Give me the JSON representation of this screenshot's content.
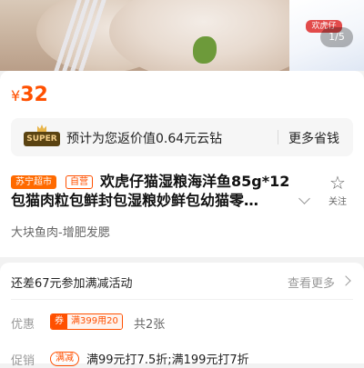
{
  "gallery": {
    "pager": "1/5",
    "brand": "欢虎仔"
  },
  "price": {
    "currency": "¥",
    "value": "32",
    "color": "#ff5000"
  },
  "cashback": {
    "badge": "SUPER",
    "text": "预计为您返价值0.64元云钻",
    "link": "更多省钱"
  },
  "product": {
    "store_tag": "苏宁超市",
    "self_tag": "自营",
    "title_line1": "欢虎仔猫湿粮海洋鱼85g*12",
    "title_line2": "包猫肉粒包鲜封包湿粮妙鲜包幼猫零…",
    "favorite_label": "关注",
    "favorite_icon": "star-outline-icon",
    "subtitle": "大块鱼肉-增肥发腮"
  },
  "promotions": {
    "threshold_text": "还差67元参加满减活动",
    "view_more": "查看更多",
    "coupon_label": "优惠",
    "coupon_tag": "券",
    "coupon_value": "满399用20",
    "coupon_count": "共2张",
    "promo_label": "促销",
    "promo_tag": "满减",
    "promo_text": "满99元打7.5折;满199元打7折"
  }
}
